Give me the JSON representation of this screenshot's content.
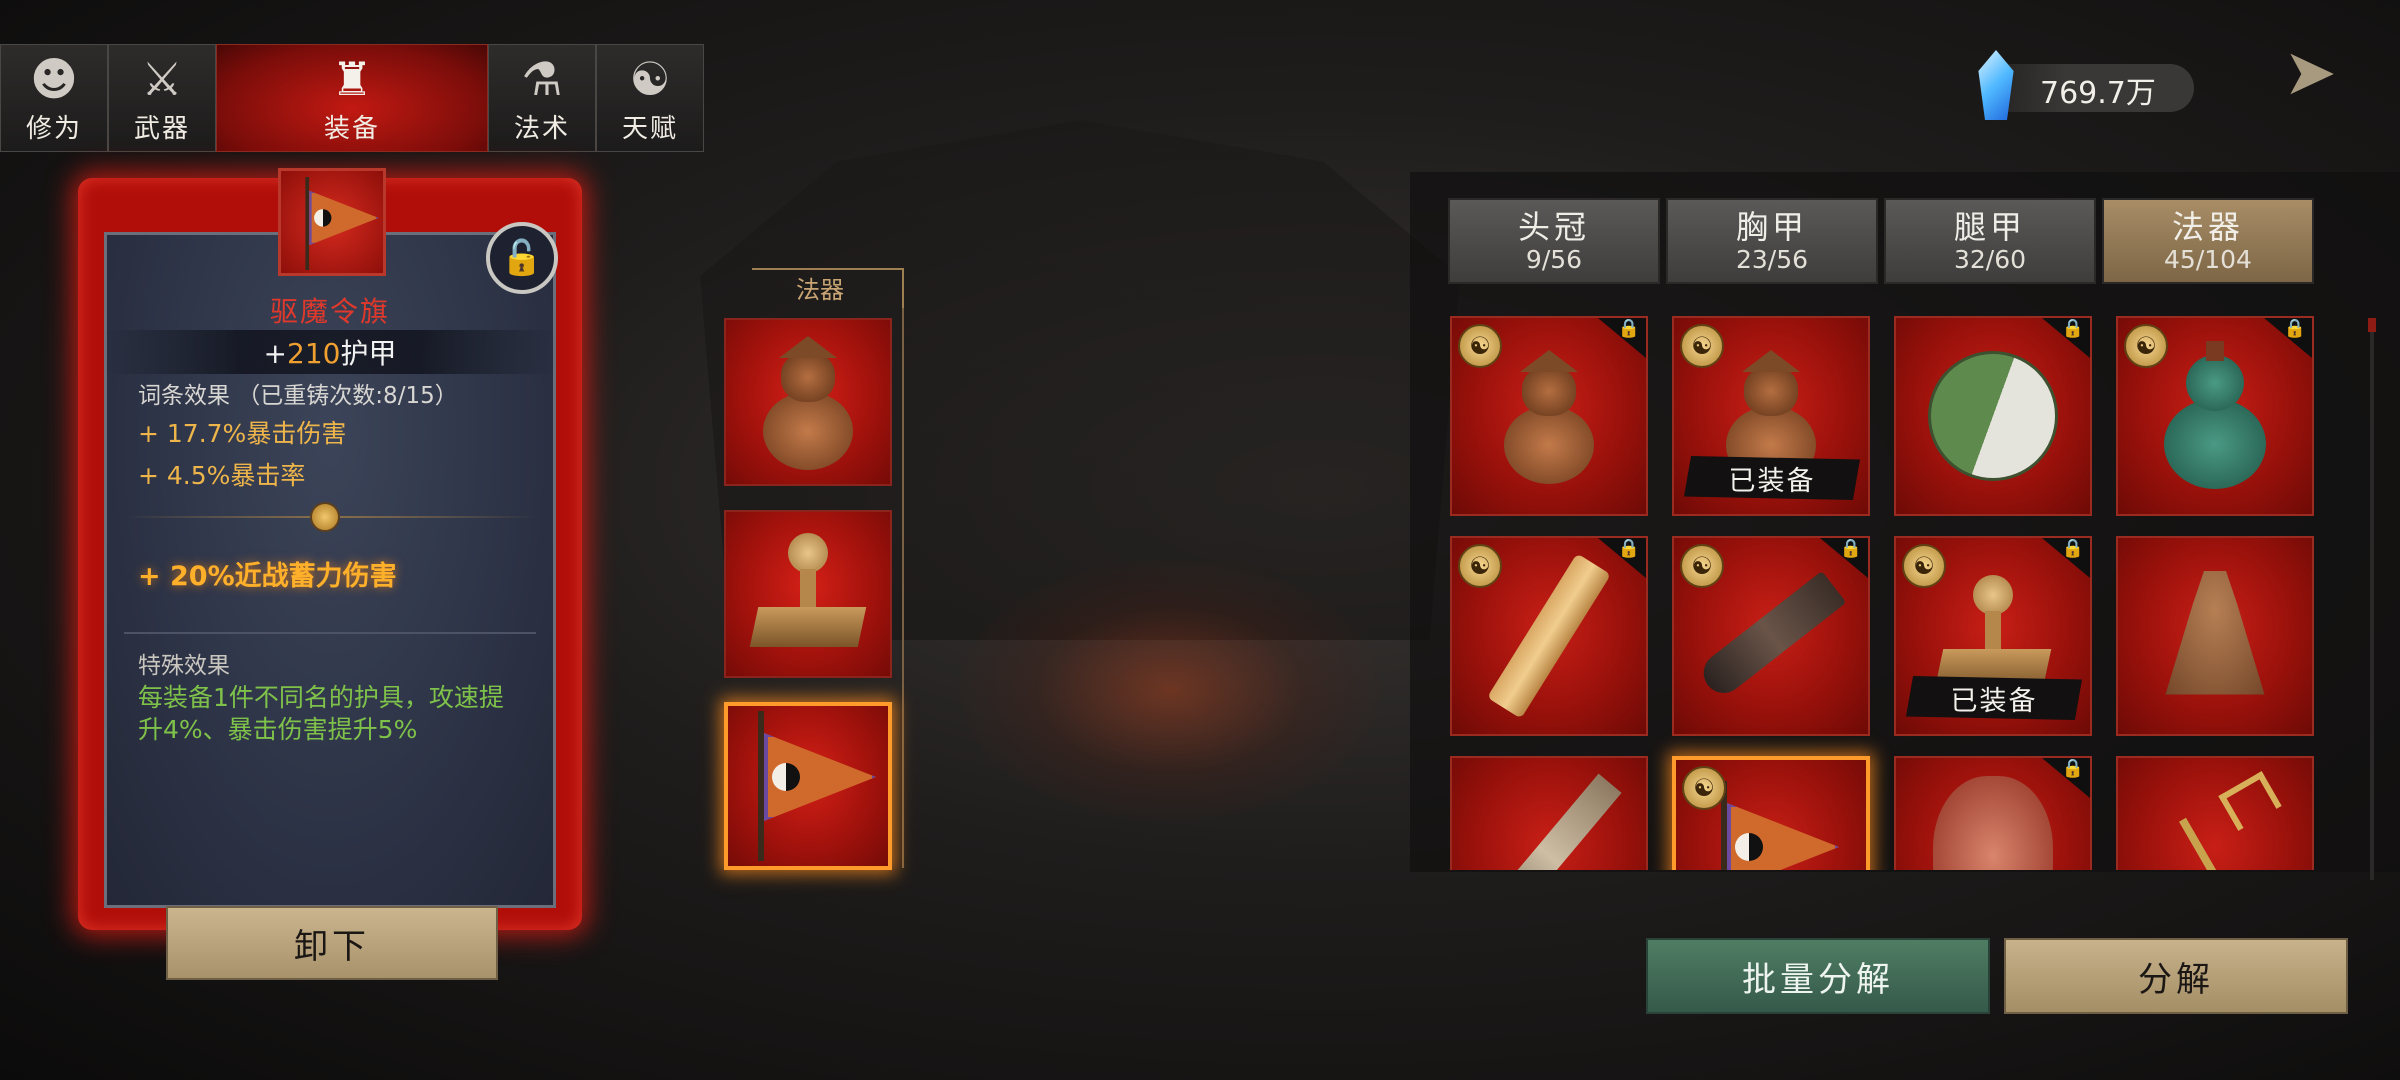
{
  "tabs": [
    {
      "label": "修为",
      "icon": "monk-head-icon",
      "glyph": "☻"
    },
    {
      "label": "武器",
      "icon": "staff-icon",
      "glyph": "⚔"
    },
    {
      "label": "装备",
      "icon": "robe-icon",
      "glyph": "♜"
    },
    {
      "label": "法术",
      "icon": "scroll-icon",
      "glyph": "⚗"
    },
    {
      "label": "天赋",
      "icon": "bagua-icon",
      "glyph": "☯"
    }
  ],
  "active_tab": "装备",
  "currency": {
    "value": "769.7万",
    "icon": "spirit-crystal-icon"
  },
  "detail": {
    "item_name": "驱魔令旗",
    "armor_prefix": "+",
    "armor_value": "210",
    "armor_label": "护甲",
    "attributes_header": "词条效果 （已重铸次数:8/15）",
    "attributes": [
      "+ 17.7%暴击伤害",
      "+ 4.5%暴击率"
    ],
    "bonus": "+ 20%近战蓄力伤害",
    "special_header": "特殊效果",
    "special_text": "每装备1件不同名的护具，攻速提升4%、暴击伤害提升5%",
    "unequip_label": "卸下",
    "lock_icon": "padlock-open-icon"
  },
  "slot_column": {
    "label": "法器",
    "slots": [
      {
        "item": "gourd-pot",
        "selected": false
      },
      {
        "item": "seal-stamp",
        "selected": false
      },
      {
        "item": "command-flag",
        "selected": true
      }
    ]
  },
  "categories": [
    {
      "name": "头冠",
      "count": "9/56",
      "active": false
    },
    {
      "name": "胸甲",
      "count": "23/56",
      "active": false
    },
    {
      "name": "腿甲",
      "count": "32/60",
      "active": false
    },
    {
      "name": "法器",
      "count": "45/104",
      "active": true
    }
  ],
  "inventory": [
    {
      "item": "gourd-pot",
      "coin": true,
      "locked": true,
      "equipped": ""
    },
    {
      "item": "gourd-pot",
      "coin": true,
      "locked": false,
      "equipped": "已装备"
    },
    {
      "item": "yinyang-jade",
      "coin": false,
      "locked": true,
      "equipped": ""
    },
    {
      "item": "green-gourd",
      "coin": true,
      "locked": true,
      "equipped": ""
    },
    {
      "item": "wooden-ruler",
      "coin": true,
      "locked": true,
      "equipped": ""
    },
    {
      "item": "horn",
      "coin": true,
      "locked": true,
      "equipped": ""
    },
    {
      "item": "seal-stamp",
      "coin": true,
      "locked": true,
      "equipped": "已装备"
    },
    {
      "item": "bell",
      "coin": false,
      "locked": false,
      "equipped": ""
    },
    {
      "item": "coin-sword",
      "coin": false,
      "locked": false,
      "equipped": ""
    },
    {
      "item": "command-flag",
      "coin": true,
      "locked": false,
      "equipped": "",
      "selected": true
    },
    {
      "item": "red-vase",
      "coin": false,
      "locked": true,
      "equipped": ""
    },
    {
      "item": "trident",
      "coin": false,
      "locked": false,
      "equipped": ""
    }
  ],
  "buttons": {
    "bulk_decompose": "批量分解",
    "decompose": "分解"
  },
  "colors": {
    "accent_red": "#c21912",
    "gold": "#c9a574",
    "bonus_orange": "#ffb02a",
    "special_green": "#7fc24a"
  }
}
